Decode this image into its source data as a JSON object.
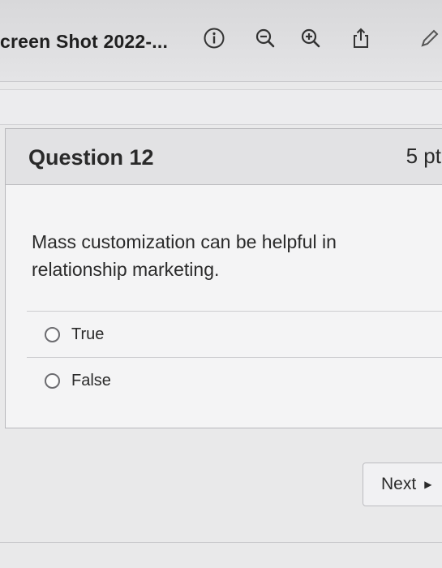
{
  "toolbar": {
    "doc_title": "creen Shot 2022-...",
    "icons": [
      "info-icon",
      "zoom-out-icon",
      "zoom-in-icon",
      "share-icon",
      "markup-pencil-icon"
    ]
  },
  "question": {
    "title": "Question 12",
    "points": "5 pt",
    "text": "Mass customization can be helpful in relationship marketing.",
    "answers": [
      {
        "label": "True",
        "selected": false
      },
      {
        "label": "False",
        "selected": false
      }
    ]
  },
  "nav": {
    "next_label": "Next"
  },
  "colors": {
    "background": "#e9e9ea",
    "text": "#2a2a2a",
    "border": "#b8b8bc"
  }
}
